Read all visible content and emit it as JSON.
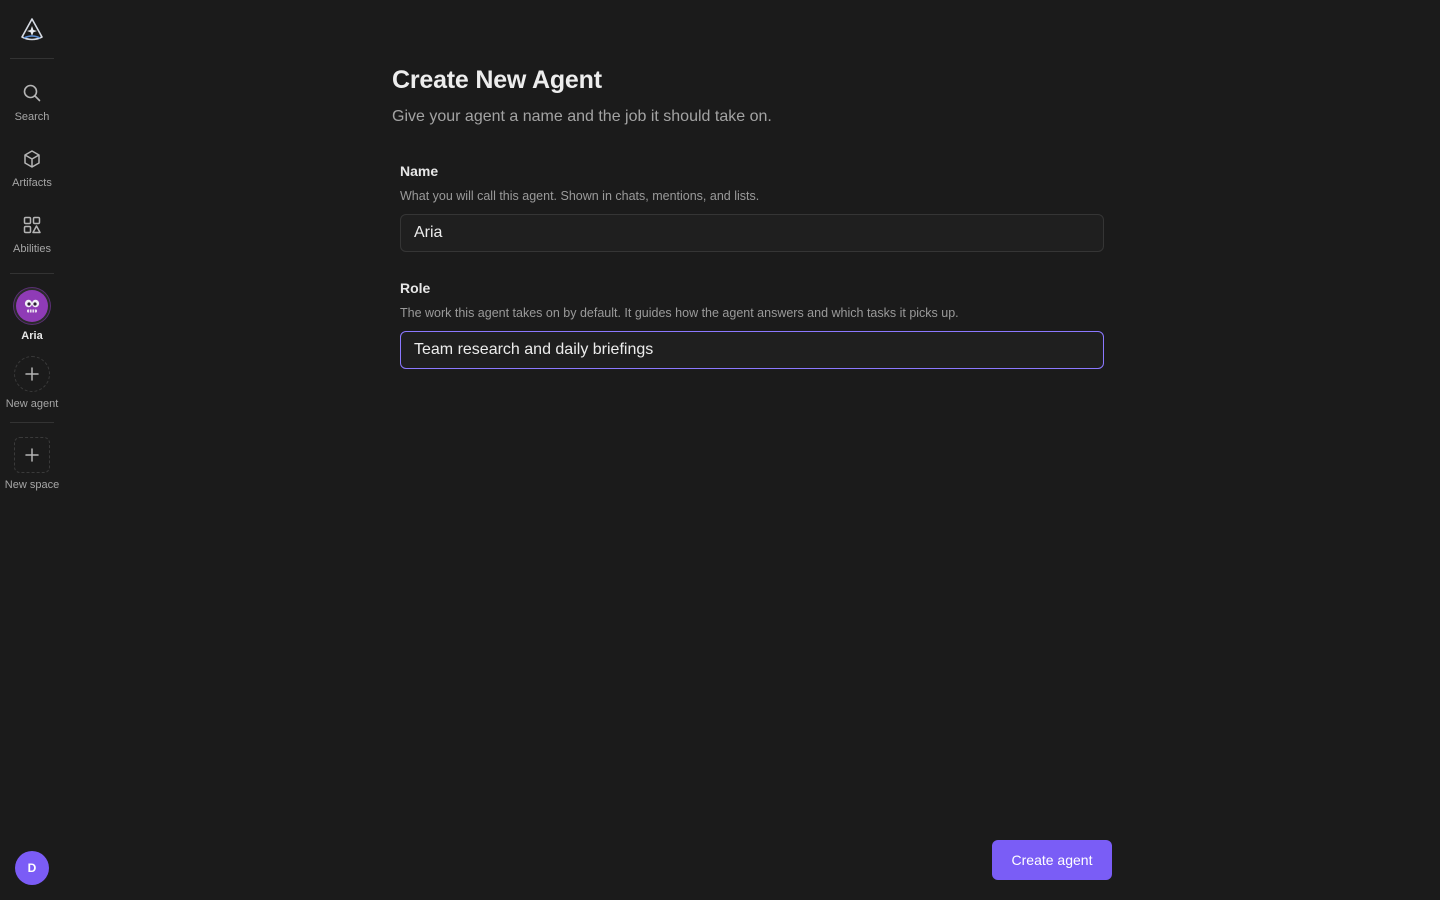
{
  "sidebar": {
    "logo_icon": "app-logo-icon",
    "items": [
      {
        "id": "search",
        "label": "Search",
        "icon": "search-icon"
      },
      {
        "id": "artifacts",
        "label": "Artifacts",
        "icon": "cube-icon"
      },
      {
        "id": "abilities",
        "label": "Abilities",
        "icon": "shapes-grid-icon"
      }
    ],
    "agent": {
      "label": "Aria",
      "icon": "robot-face-icon",
      "color": "#8f3bb6"
    },
    "new_agent": {
      "label": "New agent",
      "icon": "plus-icon"
    },
    "new_space": {
      "label": "New space",
      "icon": "plus-icon"
    },
    "user": {
      "initial": "D",
      "color": "#7b5cf6"
    }
  },
  "page": {
    "title": "Create New Agent",
    "subtitle": "Give your agent a name and the job it should take on."
  },
  "form": {
    "name": {
      "label": "Name",
      "hint": "What you will call this agent. Shown in chats, mentions, and lists.",
      "value": "Aria"
    },
    "role": {
      "label": "Role",
      "hint": "The work this agent takes on by default. It guides how the agent answers and which tasks it picks up.",
      "value": "Team research and daily briefings"
    }
  },
  "actions": {
    "create_label": "Create agent",
    "accent": "#7a5df6"
  }
}
